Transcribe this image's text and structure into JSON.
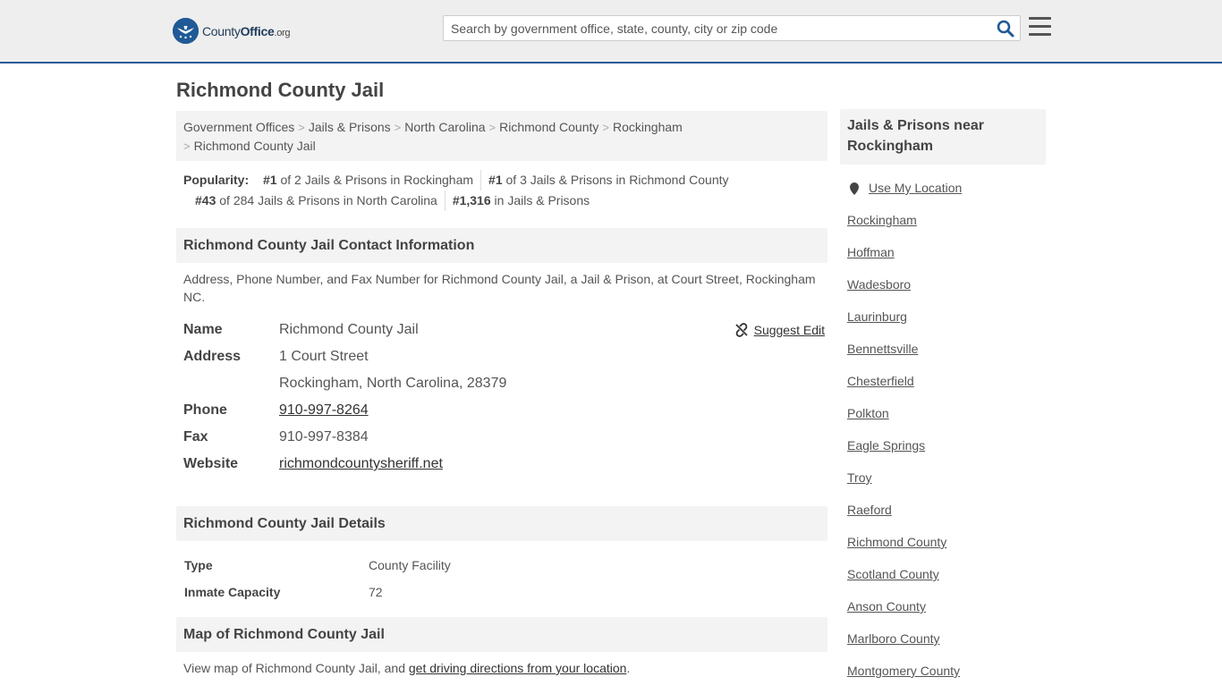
{
  "header": {
    "logo_name": "County",
    "logo_name_bold": "Office",
    "logo_tld": ".org",
    "search_placeholder": "Search by government office, state, county, city or zip code",
    "accent_color": "#1f5a96"
  },
  "page_title": "Richmond County Jail",
  "breadcrumb": [
    "Government Offices",
    "Jails & Prisons",
    "North Carolina",
    "Richmond County",
    "Rockingham",
    "Richmond County Jail"
  ],
  "popularity": {
    "label": "Popularity:",
    "items": [
      {
        "rank": "#1",
        "text": "of 2 Jails & Prisons in Rockingham"
      },
      {
        "rank": "#1",
        "text": "of 3 Jails & Prisons in Richmond County"
      },
      {
        "rank": "#43",
        "text": "of 284 Jails & Prisons in North Carolina"
      },
      {
        "rank": "#1,316",
        "text": "in Jails & Prisons"
      }
    ]
  },
  "contact": {
    "heading": "Richmond County Jail Contact Information",
    "description": "Address, Phone Number, and Fax Number for Richmond County Jail, a Jail & Prison, at Court Street, Rockingham NC.",
    "suggest_edit": "Suggest Edit",
    "name_label": "Name",
    "name": "Richmond County Jail",
    "address_label": "Address",
    "address_line1": "1 Court Street",
    "address_line2": "Rockingham, North Carolina, 28379",
    "phone_label": "Phone",
    "phone": "910-997-8264",
    "fax_label": "Fax",
    "fax": "910-997-8384",
    "website_label": "Website",
    "website": "richmondcountysheriff.net"
  },
  "details": {
    "heading": "Richmond County Jail Details",
    "type_label": "Type",
    "type": "County Facility",
    "capacity_label": "Inmate Capacity",
    "capacity": "72"
  },
  "map": {
    "heading": "Map of Richmond County Jail",
    "text": "View map of Richmond County Jail, and ",
    "link": "get driving directions from your location",
    "text_end": "."
  },
  "sidebar": {
    "heading": "Jails & Prisons near Rockingham",
    "use_location": "Use My Location",
    "items": [
      "Rockingham",
      "Hoffman",
      "Wadesboro",
      "Laurinburg",
      "Bennettsville",
      "Chesterfield",
      "Polkton",
      "Eagle Springs",
      "Troy",
      "Raeford",
      "Richmond County",
      "Scotland County",
      "Anson County",
      "Marlboro County",
      "Montgomery County"
    ]
  }
}
